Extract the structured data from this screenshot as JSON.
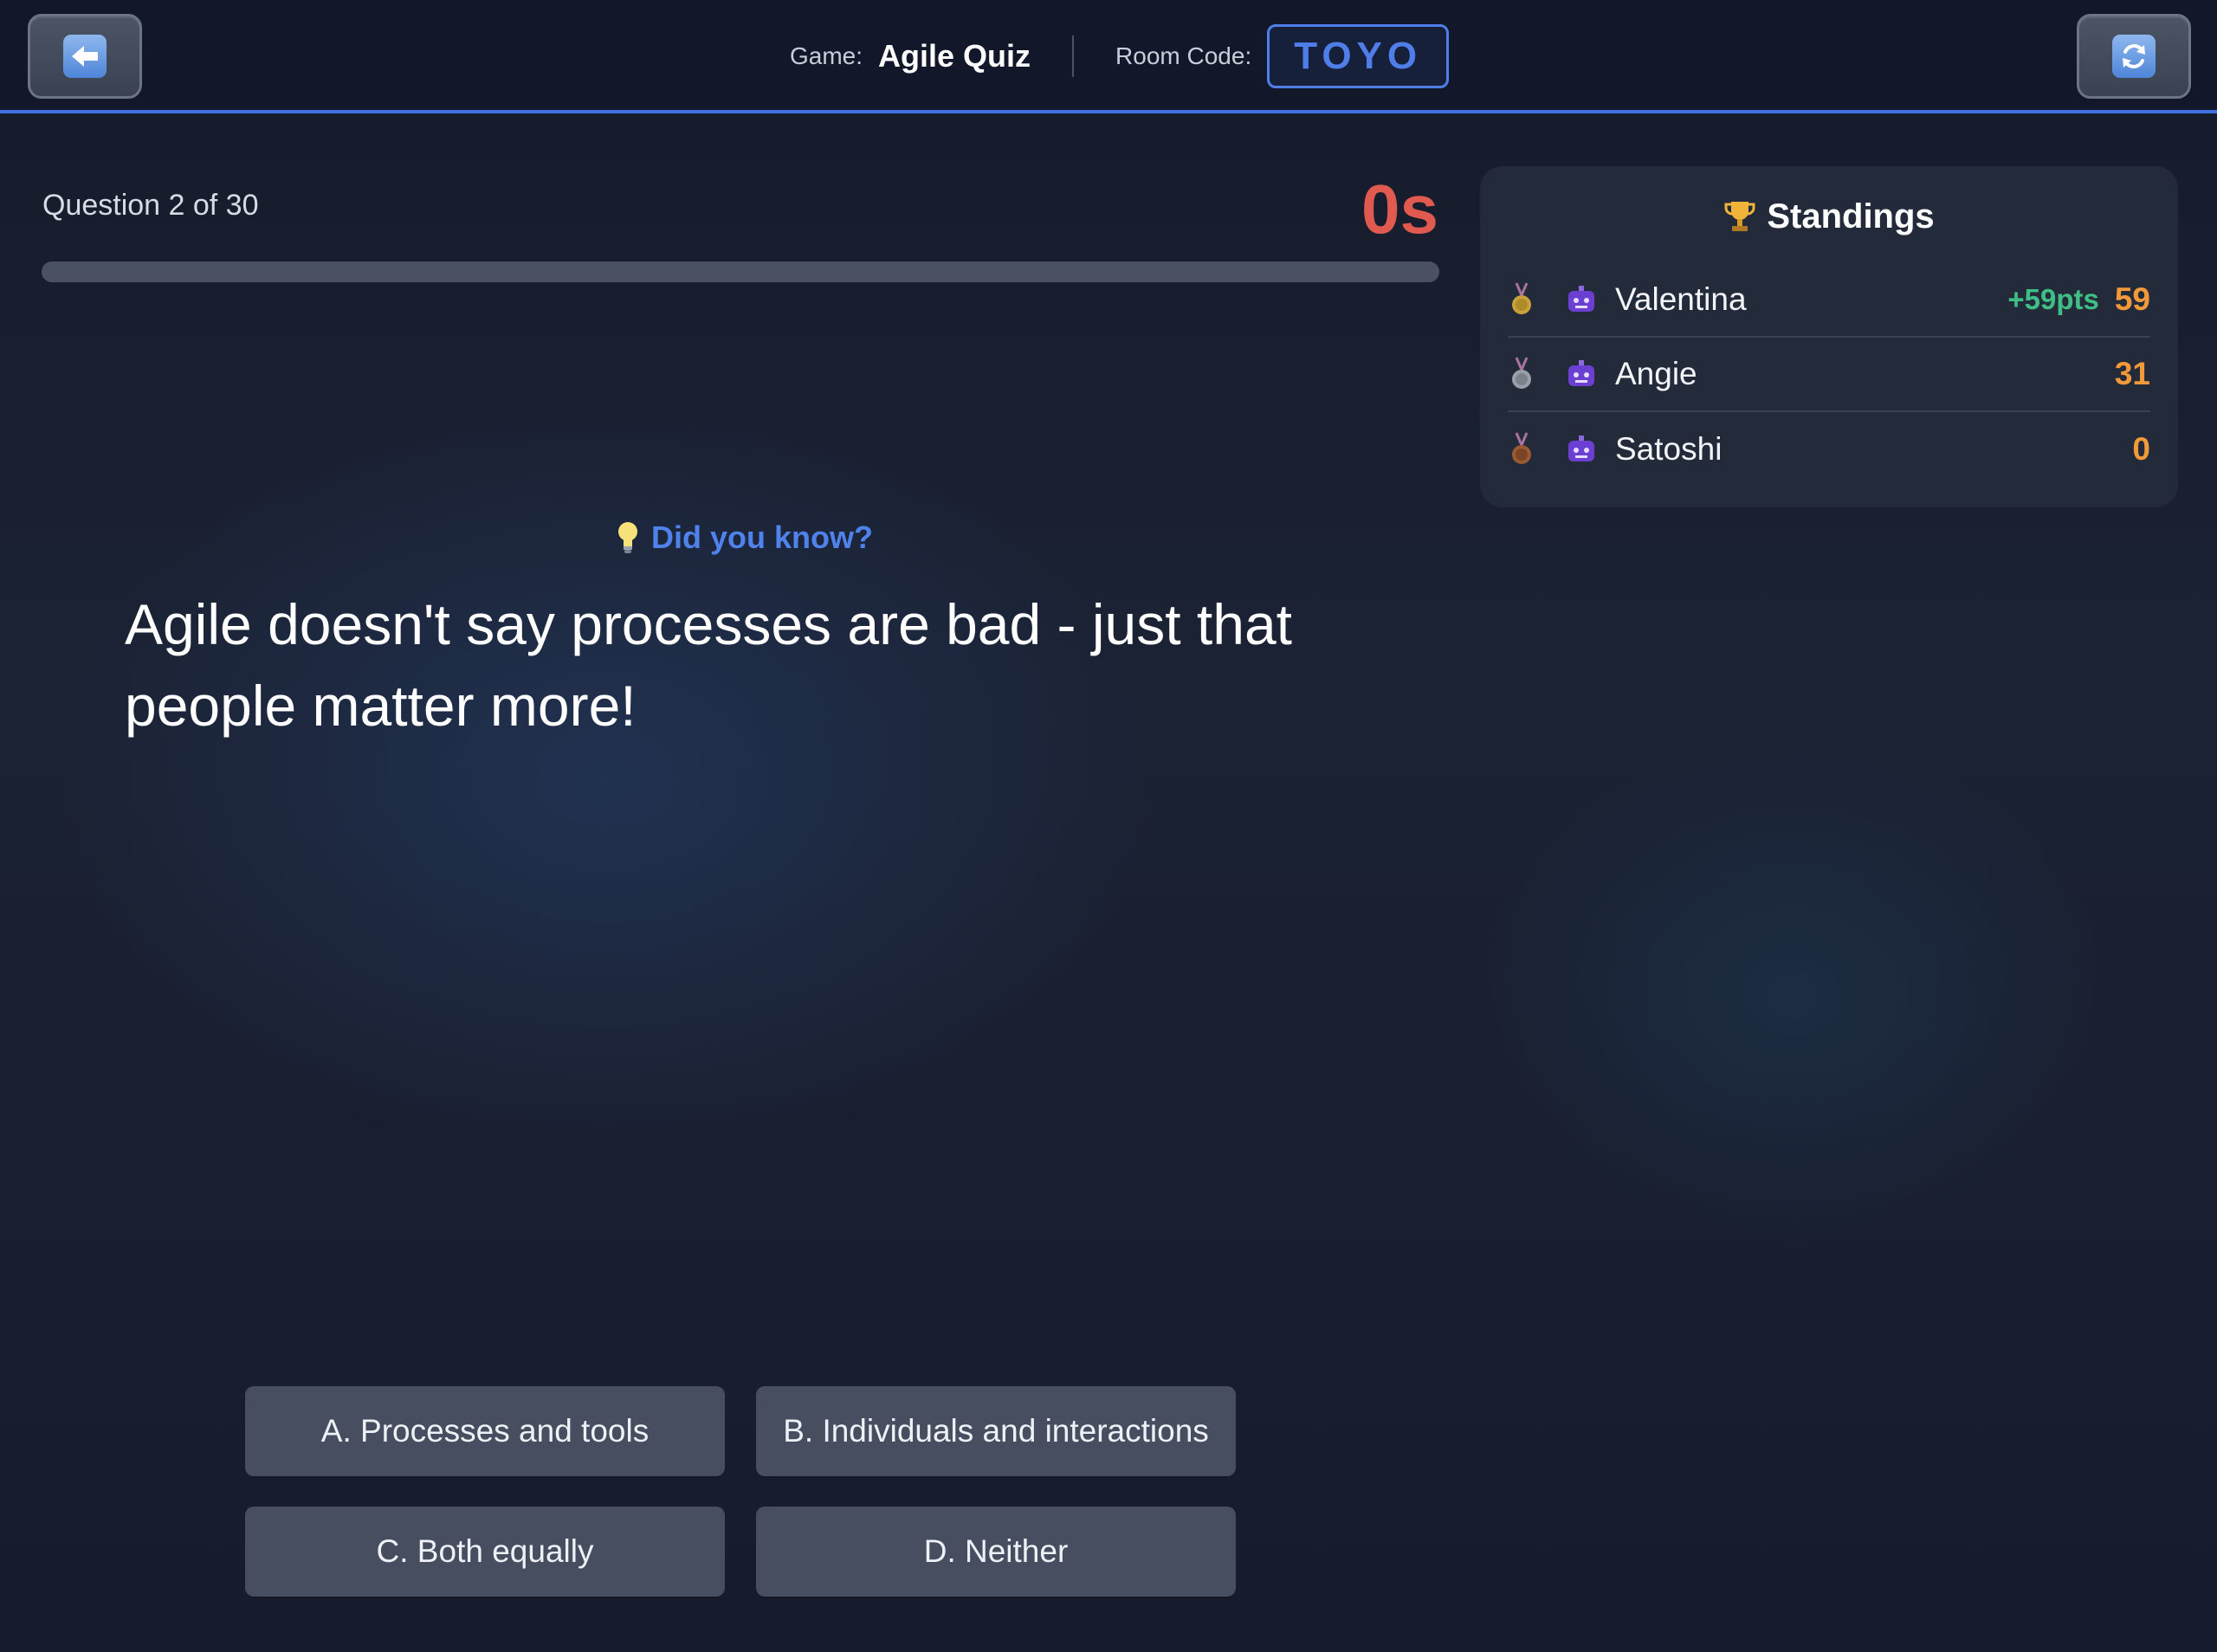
{
  "header": {
    "game_label": "Game:",
    "game_name": "Agile Quiz",
    "room_label": "Room Code:",
    "room_code": "TOYO",
    "back_icon": "back-arrow-icon",
    "refresh_icon": "refresh-icon"
  },
  "question": {
    "counter": "Question 2 of 30",
    "timer": "0s",
    "progress_fraction": 0
  },
  "fact": {
    "heading": "Did you know?",
    "text": "Agile doesn't say processes are bad - just that people matter more!",
    "icon": "lightbulb-icon"
  },
  "answers": [
    {
      "label": "A. Processes and tools"
    },
    {
      "label": "B. Individuals and interactions"
    },
    {
      "label": "C. Both equally"
    },
    {
      "label": "D. Neither"
    }
  ],
  "standings": {
    "title": "Standings",
    "icon": "trophy-icon",
    "players": [
      {
        "medal": "gold-medal-icon",
        "avatar": "robot-avatar-icon",
        "name": "Valentina",
        "delta": "+59pts",
        "score": "59"
      },
      {
        "medal": "silver-medal-icon",
        "avatar": "robot-avatar-icon",
        "name": "Angie",
        "delta": "",
        "score": "31"
      },
      {
        "medal": "bronze-medal-icon",
        "avatar": "robot-avatar-icon",
        "name": "Satoshi",
        "delta": "",
        "score": "0"
      }
    ]
  },
  "colors": {
    "accent": "#4f7ee8",
    "timer": "#e05a50",
    "score": "#f29a3a",
    "delta": "#3fbf86"
  }
}
